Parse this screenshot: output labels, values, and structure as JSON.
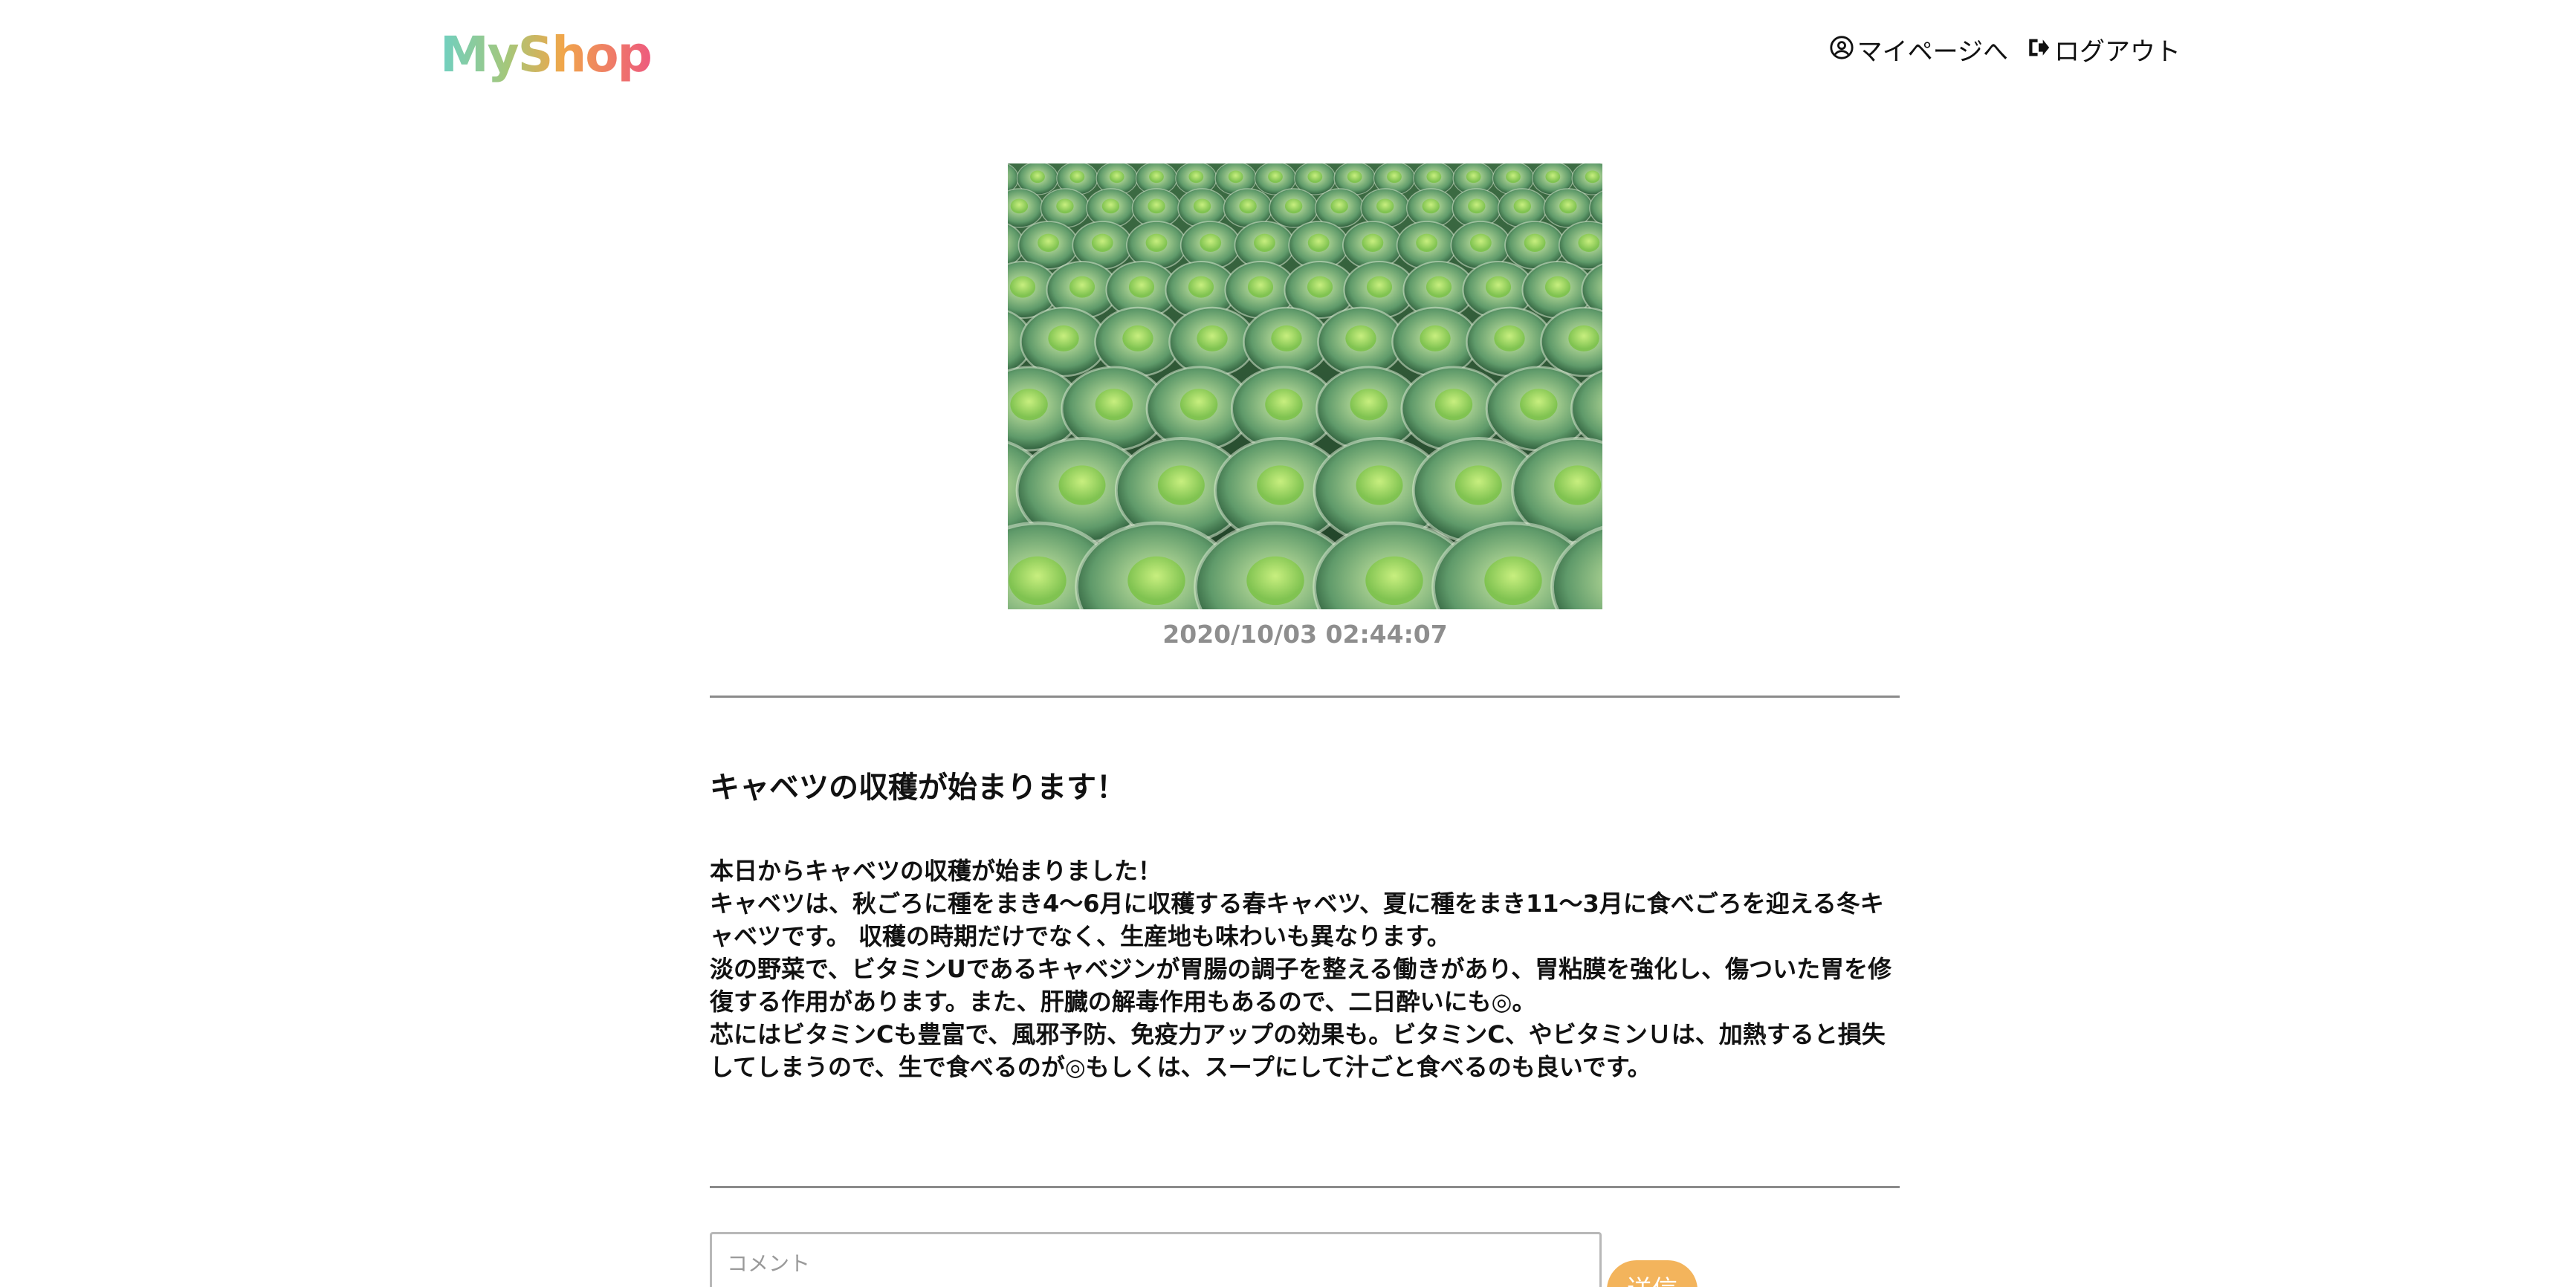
{
  "header": {
    "logo": "MyShop",
    "nav": {
      "mypage_label": "マイページへ",
      "logout_label": "ログアウト"
    }
  },
  "post": {
    "date": "2020/10/03 02:44:07",
    "title": "キャベツの収穫が始まります！",
    "paragraphs": [
      "本日からキャベツの収穫が始まりました！",
      "キャベツは、秋ごろに種をまき4〜6月に収穫する春キャベツ、夏に種をまき11〜3月に食べごろを迎える冬キャベツです。 収穫の時期だけでなく、生産地も味わいも異なります。",
      "淡の野菜で、ビタミンUであるキャベジンが胃腸の調子を整える働きがあり、胃粘膜を強化し、傷ついた胃を修復する作用があります。また、肝臓の解毒作用もあるので、二日酔いにも◎。",
      "芯にはビタミンCも豊富で、風邪予防、免疫力アップの効果も。ビタミンC、やビタミンＵは、加熱すると損失してしまうので、生で食べるのが◎もしくは、スープにして汁ごと食べるのも良いです。"
    ]
  },
  "comment_form": {
    "placeholder": "コメント",
    "submit_label": "送信"
  },
  "icons": {
    "mypage": "user-circle-icon",
    "logout": "sign-out-icon"
  },
  "colors": {
    "accent_button": "#f3b45c",
    "date_text": "#8e8e8e"
  }
}
